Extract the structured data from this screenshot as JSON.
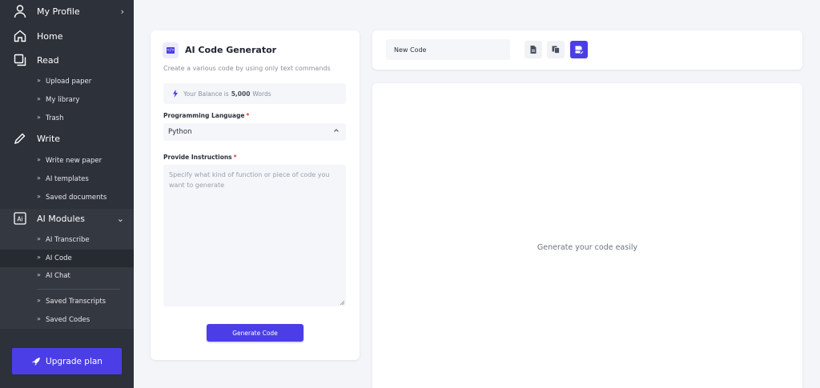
{
  "sidebar": {
    "profile": {
      "label": "My Profile",
      "chevron": "›"
    },
    "home": {
      "label": "Home"
    },
    "read": {
      "label": "Read",
      "items": [
        "Upload paper",
        "My library",
        "Trash"
      ]
    },
    "write": {
      "label": "Write",
      "items": [
        "Write new paper",
        "AI templates",
        "Saved documents"
      ]
    },
    "ai_modules": {
      "label": "AI Modules",
      "chevron": "⌄",
      "items": [
        "AI Transcribe",
        "AI Code",
        "AI Chat"
      ],
      "saved": [
        "Saved Transcripts",
        "Saved Codes"
      ],
      "active": "AI Code"
    },
    "upgrade_label": "Upgrade plan",
    "bullet": "»"
  },
  "generator": {
    "title": "AI Code Generator",
    "subtitle": "Create a various code by using only text commands",
    "balance_prefix": "Your Balance is",
    "balance_value": "5,000",
    "balance_suffix": "Words",
    "language_label": "Programming Language",
    "required_mark": "*",
    "language_value": "Python",
    "instructions_label": "Provide Instructions",
    "instructions_placeholder": "Specify what kind of function or piece of code you want to generate",
    "generate_button": "Generate Code"
  },
  "output": {
    "name_value": "New Code",
    "placeholder": "Generate your code easily"
  },
  "colors": {
    "accent": "#4b3ee6",
    "sidebar": "#2d3139",
    "background": "#f3f5f9",
    "required": "#e53935"
  },
  "icons": [
    "user-icon",
    "home-icon",
    "book-icon",
    "pencil-icon",
    "ai-chip-icon",
    "rocket-icon",
    "code-icon",
    "bolt-icon",
    "chevron-up-icon",
    "file-icon",
    "copy-icon",
    "save-icon"
  ]
}
